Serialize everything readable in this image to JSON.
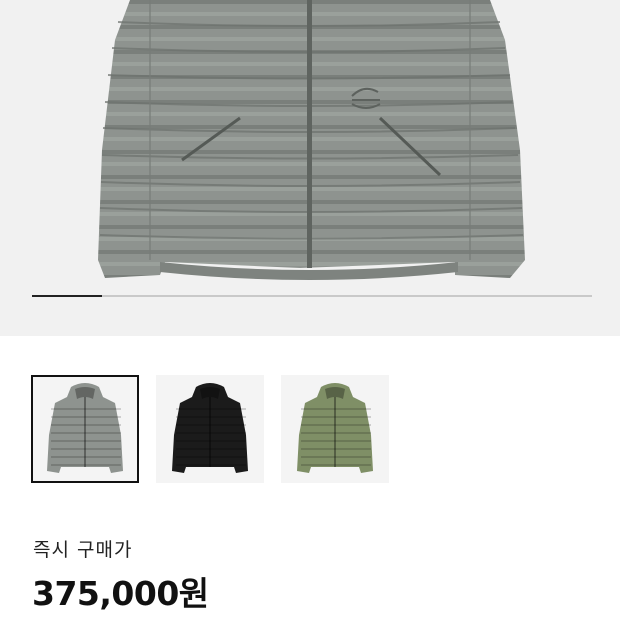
{
  "product": {
    "price_label": "즉시 구매가",
    "price": "375,000원",
    "gallery_progress": 0.125
  },
  "thumbnails": [
    {
      "color_name": "gray",
      "color": "#8e938f",
      "selected": true
    },
    {
      "color_name": "black",
      "color": "#1b1b1b",
      "selected": false
    },
    {
      "color_name": "olive",
      "color": "#7f8f66",
      "selected": false
    }
  ],
  "colors": {
    "hero_background": "#f1f1f1",
    "jacket_gray": "#8e938f"
  }
}
